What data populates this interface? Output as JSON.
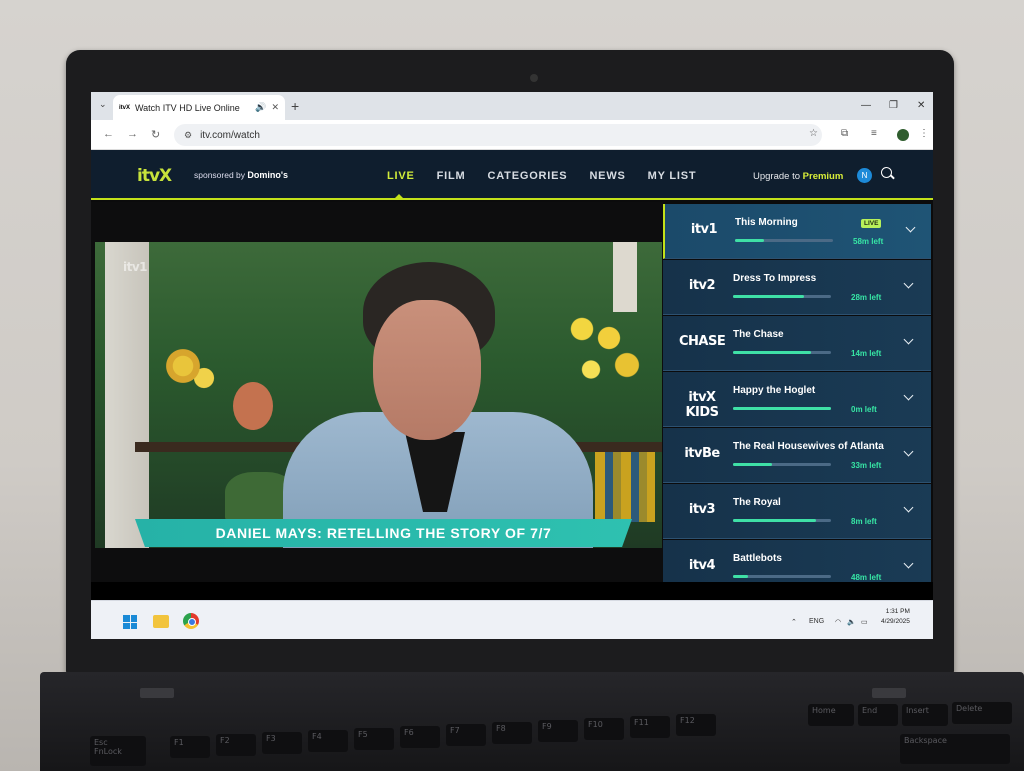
{
  "browser": {
    "tab_title": "Watch ITV HD Live Online",
    "tab_favicon": "itvX",
    "url": "itv.com/watch"
  },
  "itvx": {
    "logo": "itvX",
    "sponsor_prefix": "sponsored by",
    "sponsor_name": "Domino's",
    "nav": [
      "LIVE",
      "FILM",
      "CATEGORIES",
      "NEWS",
      "MY LIST"
    ],
    "active_nav": "LIVE",
    "upgrade_prefix": "Upgrade to",
    "upgrade_highlight": "Premium",
    "user_initial": "N",
    "accent_color": "#c3e21a"
  },
  "player": {
    "watermark": "itv1",
    "lower_third": "DANIEL MAYS: RETELLING THE STORY OF 7/7"
  },
  "channels": [
    {
      "logo": "itv1",
      "title": "This Morning",
      "time_left": "58m left",
      "progress": 0.3,
      "live_badge": "LIVE",
      "selected": true
    },
    {
      "logo": "itv2",
      "title": "Dress To Impress",
      "time_left": "28m left",
      "progress": 0.72
    },
    {
      "logo": "CHASE",
      "title": "The Chase",
      "time_left": "14m left",
      "progress": 0.8
    },
    {
      "logo": "itvX KIDS",
      "title": "Happy the Hoglet",
      "time_left": "0m left",
      "progress": 1.0
    },
    {
      "logo": "itvBe",
      "title": "The Real Housewives of Atlanta",
      "time_left": "33m left",
      "progress": 0.4
    },
    {
      "logo": "itv3",
      "title": "The Royal",
      "time_left": "8m left",
      "progress": 0.85
    },
    {
      "logo": "itv4",
      "title": "Battlebots",
      "time_left": "48m left",
      "progress": 0.15
    }
  ],
  "taskbar": {
    "lang": "ENG",
    "time": "1:31 PM",
    "date": "4/29/2025"
  },
  "keyboard": {
    "esc": "Esc",
    "fnlock": "FnLock",
    "fkeys": [
      "F1",
      "F2",
      "F3",
      "F4",
      "F5",
      "F6",
      "F7",
      "F8",
      "F9",
      "F10",
      "F11",
      "F12"
    ],
    "home": "Home",
    "end": "End",
    "insert": "Insert",
    "delete": "Delete",
    "backspace": "Backspace"
  }
}
